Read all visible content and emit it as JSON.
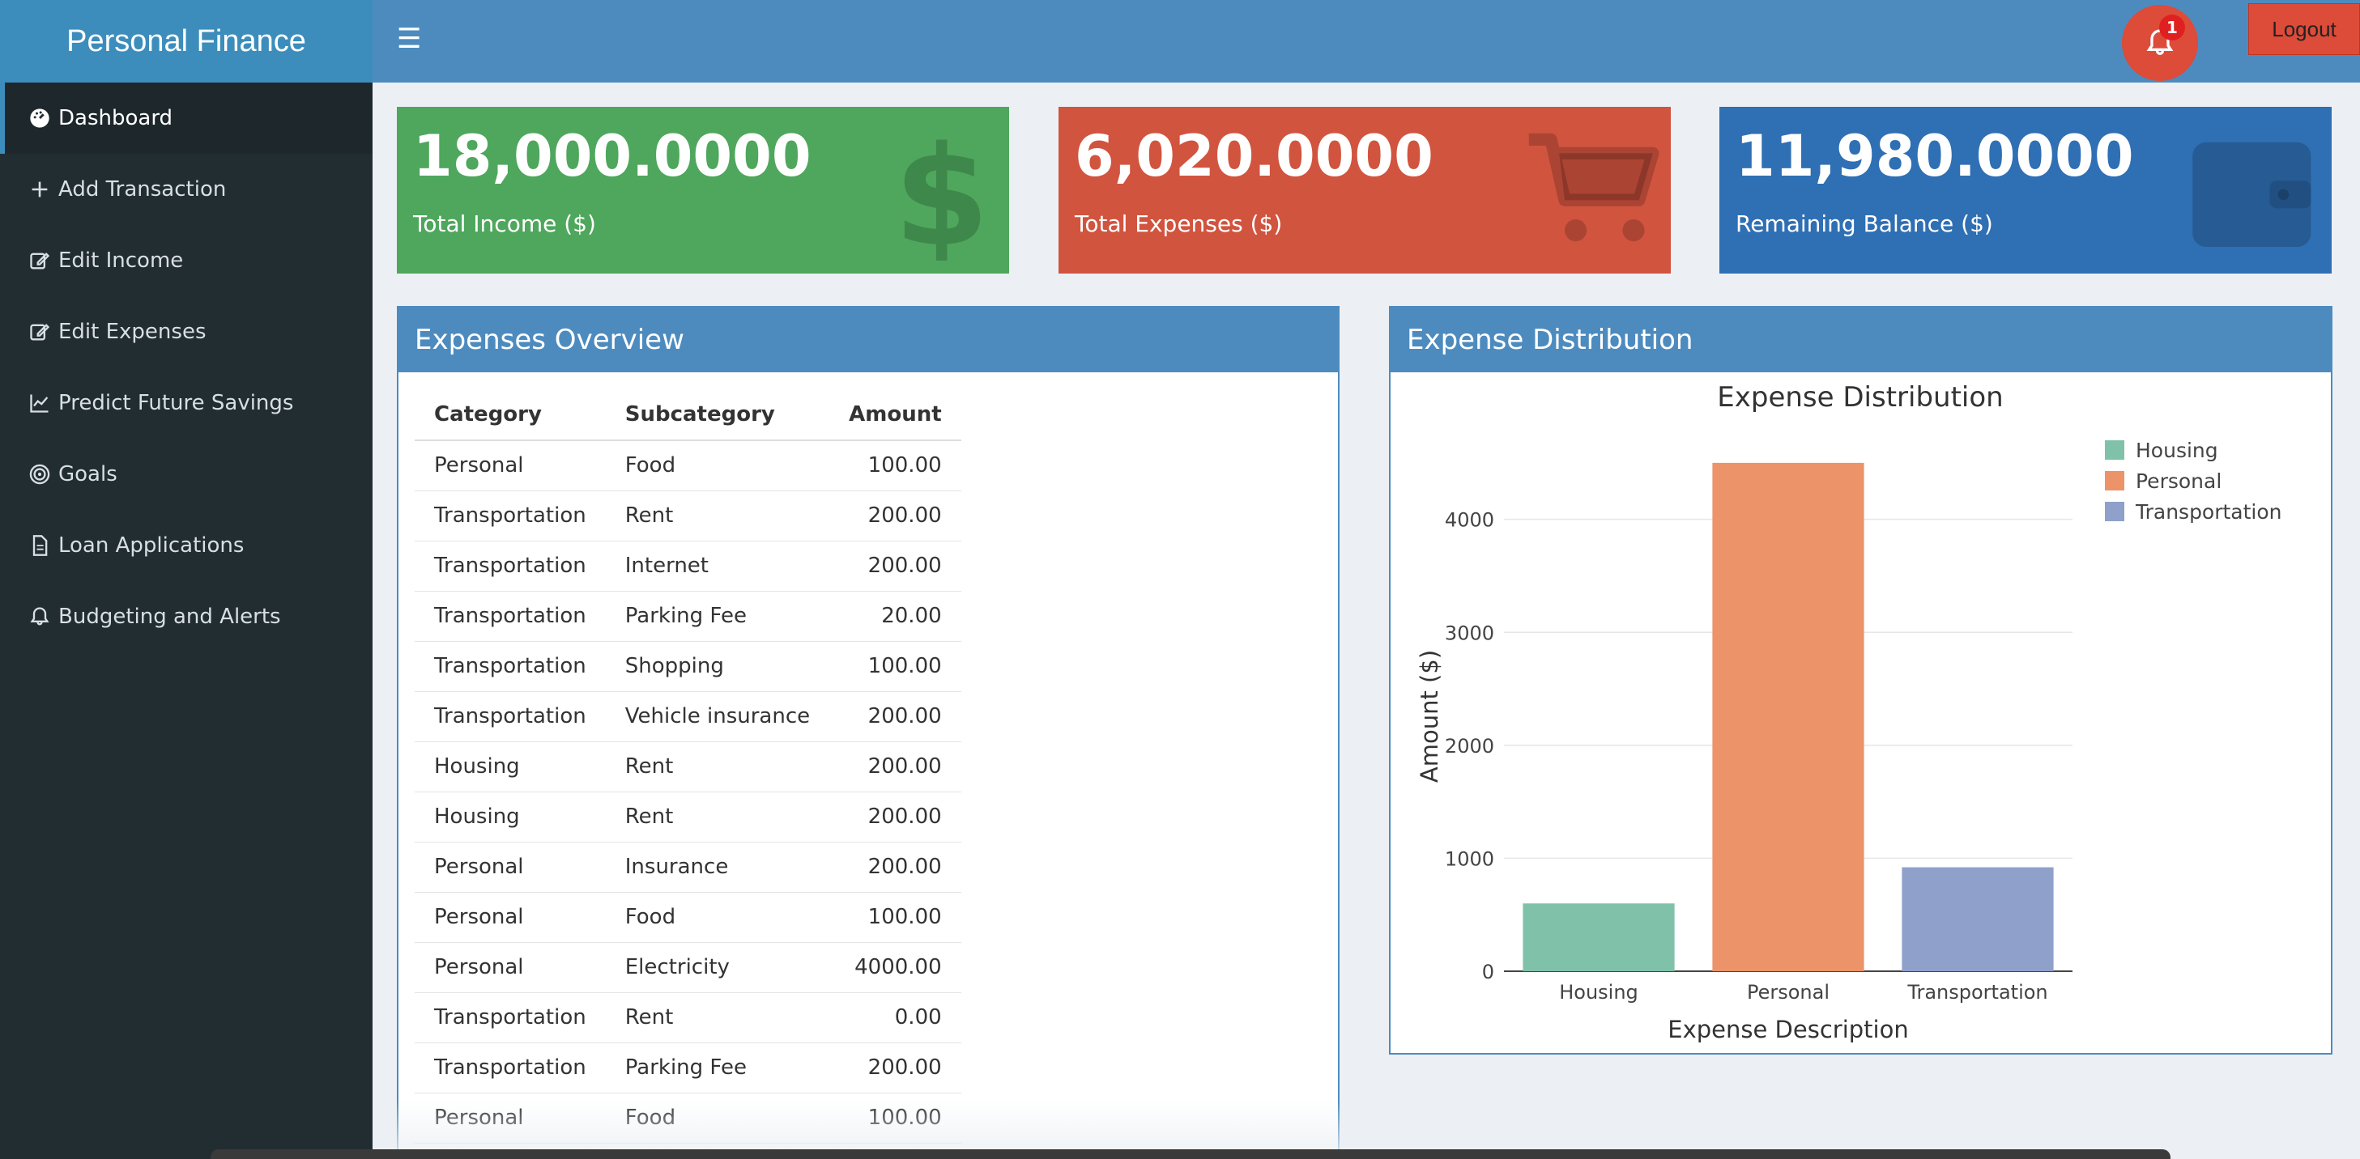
{
  "app": {
    "title": "Personal Finance"
  },
  "header": {
    "notification_count": "1",
    "logout_label": "Logout"
  },
  "sidebar": {
    "items": [
      {
        "label": "Dashboard",
        "icon": "dashboard-icon"
      },
      {
        "label": "Add Transaction",
        "icon": "plus-icon"
      },
      {
        "label": "Edit Income",
        "icon": "edit-icon"
      },
      {
        "label": "Edit Expenses",
        "icon": "edit-icon"
      },
      {
        "label": "Predict Future Savings",
        "icon": "line-chart-icon"
      },
      {
        "label": "Goals",
        "icon": "target-icon"
      },
      {
        "label": "Loan Applications",
        "icon": "document-icon"
      },
      {
        "label": "Budgeting and Alerts",
        "icon": "bell-icon"
      }
    ]
  },
  "stats": {
    "income": {
      "value": "18,000.0000",
      "label": "Total Income ($)",
      "color": "#4ea75c",
      "icon": "dollar-icon"
    },
    "expenses": {
      "value": "6,020.0000",
      "label": "Total Expenses ($)",
      "color": "#d1543f",
      "icon": "cart-icon"
    },
    "balance": {
      "value": "11,980.0000",
      "label": "Remaining Balance ($)",
      "color": "#2f6fb4",
      "icon": "wallet-icon"
    }
  },
  "overview": {
    "title": "Expenses Overview",
    "columns": [
      "Category",
      "Subcategory",
      "Amount"
    ],
    "rows": [
      [
        "Personal",
        "Food",
        "100.00"
      ],
      [
        "Transportation",
        "Rent",
        "200.00"
      ],
      [
        "Transportation",
        "Internet",
        "200.00"
      ],
      [
        "Transportation",
        "Parking Fee",
        "20.00"
      ],
      [
        "Transportation",
        "Shopping",
        "100.00"
      ],
      [
        "Transportation",
        "Vehicle insurance",
        "200.00"
      ],
      [
        "Housing",
        "Rent",
        "200.00"
      ],
      [
        "Housing",
        "Rent",
        "200.00"
      ],
      [
        "Personal",
        "Insurance",
        "200.00"
      ],
      [
        "Personal",
        "Food",
        "100.00"
      ],
      [
        "Personal",
        "Electricity",
        "4000.00"
      ],
      [
        "Transportation",
        "Rent",
        "0.00"
      ],
      [
        "Transportation",
        "Parking Fee",
        "200.00"
      ],
      [
        "Personal",
        "Food",
        "100.00"
      ]
    ]
  },
  "distribution": {
    "title": "Expense Distribution"
  },
  "chart_data": {
    "type": "bar",
    "title": "Expense Distribution",
    "xlabel": "Expense Description",
    "ylabel": "Amount ($)",
    "categories": [
      "Housing",
      "Personal",
      "Transportation"
    ],
    "values": [
      600,
      4500,
      920
    ],
    "colors": [
      "#7fc1a9",
      "#ec936a",
      "#8fa0cb"
    ],
    "ylim": [
      0,
      4800
    ],
    "yticks": [
      0,
      1000,
      2000,
      3000,
      4000
    ],
    "legend": [
      "Housing",
      "Personal",
      "Transportation"
    ],
    "legend_position": "top-right",
    "grid": true
  }
}
